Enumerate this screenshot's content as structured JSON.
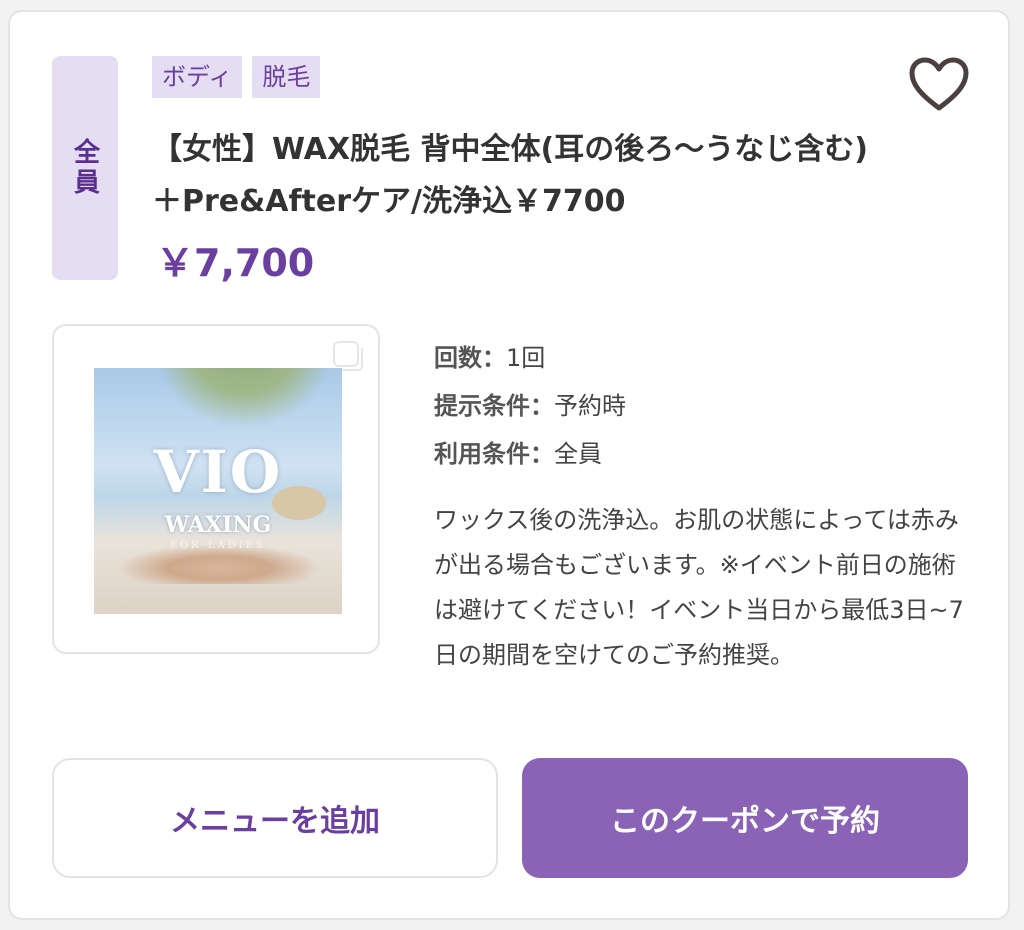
{
  "coupon": {
    "target_badge": "全員",
    "tags": [
      "ボディ",
      "脱毛"
    ],
    "title": "【女性】WAX脱毛 背中全体(耳の後ろ～うなじ含む)＋Pre&Afterケア/洗浄込￥7700",
    "price": "￥7,700",
    "favorite_icon": "heart-outline-icon",
    "image": {
      "logo_main": "VIO",
      "logo_sub": "WAXING",
      "logo_small": "FOR LADIES"
    },
    "details": [
      {
        "label": "回数：",
        "value": "1回"
      },
      {
        "label": "提示条件：",
        "value": "予約時"
      },
      {
        "label": "利用条件：",
        "value": "全員"
      }
    ],
    "description": "ワックス後の洗浄込。お肌の状態によっては赤みが出る場合もございます。※イベント前日の施術は避けてください！イベント当日から最低3日~7日の期間を空けてのご予約推奨。",
    "buttons": {
      "add_menu": "メニューを追加",
      "reserve": "このクーポンで予約"
    }
  },
  "colors": {
    "accent": "#6b3fa0",
    "badge_bg": "#e5ddf2",
    "primary_button": "#8a63b7"
  }
}
